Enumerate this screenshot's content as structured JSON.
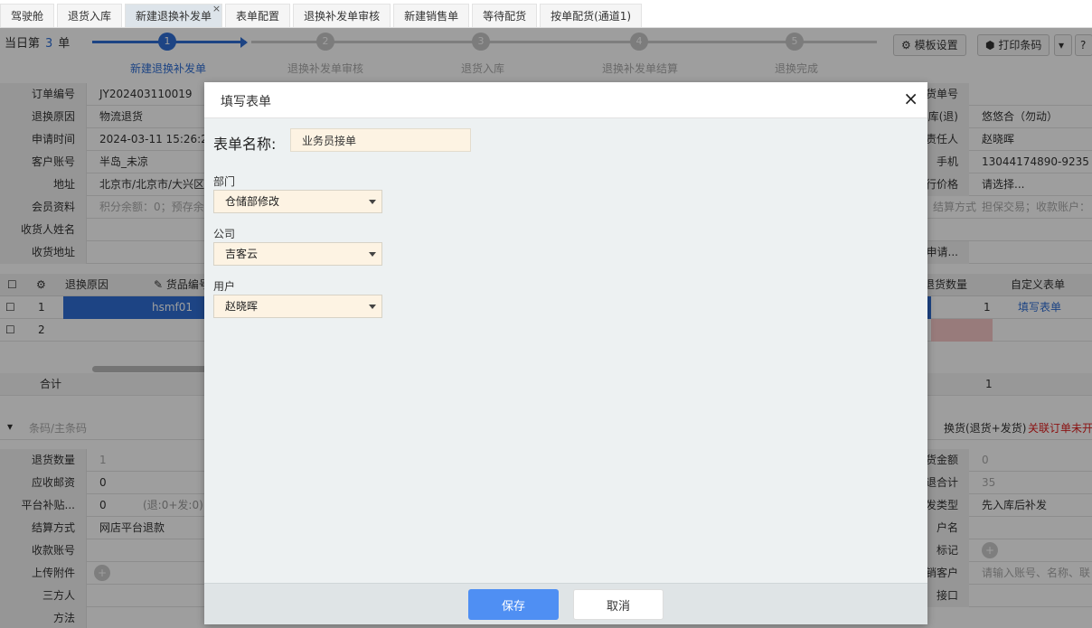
{
  "tabs": [
    {
      "label": "驾驶舱"
    },
    {
      "label": "退货入库"
    },
    {
      "label": "新建退换补发单",
      "active": true,
      "close": "×"
    },
    {
      "label": "表单配置"
    },
    {
      "label": "退换补发单审核"
    },
    {
      "label": "新建销售单"
    },
    {
      "label": "等待配货"
    },
    {
      "label": "按单配货(通道1)"
    }
  ],
  "header": {
    "count_prefix": "当日第",
    "count_value": "3",
    "count_suffix": "单",
    "template_btn": "模板设置",
    "print_btn": "打印条码",
    "help_btn": "?"
  },
  "steps": [
    {
      "num": "1",
      "label": "新建退换补发单"
    },
    {
      "num": "2",
      "label": "退换补发单审核"
    },
    {
      "num": "3",
      "label": "退货入库"
    },
    {
      "num": "4",
      "label": "退换补发单结算"
    },
    {
      "num": "5",
      "label": "退换完成"
    }
  ],
  "form_rows": [
    {
      "label": "订单编号",
      "value": "JY202403110019",
      "right_label": "货单号",
      "right_value": ""
    },
    {
      "label": "退换原因",
      "value": "物流退货",
      "right_label": "库(退)",
      "right_value": "悠悠合（勿动）"
    },
    {
      "label": "申请时间",
      "value": "2024-03-11 15:26:28",
      "right_label": "责任人",
      "right_value": "赵晓晖"
    },
    {
      "label": "客户账号",
      "value": "半岛_未凉",
      "right_label": "手机",
      "right_value": "13044174890-9235"
    },
    {
      "label": "地址",
      "value": "北京市/北京市/大兴区",
      "right_label": "行价格",
      "right_value": "请选择..."
    },
    {
      "label": "会员资料",
      "value": "积分余额：0；预存余",
      "right_label": "结算方式",
      "right_value": "担保交易；收款账户："
    },
    {
      "label": "收货人姓名",
      "value": "",
      "right_label": "",
      "right_value": ""
    },
    {
      "label": "收货地址",
      "value": "",
      "right_label": "申请...",
      "right_value": ""
    }
  ],
  "grid": {
    "headers": {
      "reason": "退换原因",
      "code": "货品编号",
      "return_qty": "退货数量",
      "custom_form": "自定义表单"
    },
    "rows": [
      {
        "num": "1",
        "code": "hsmf01",
        "qty": "1",
        "link": "填写表单"
      },
      {
        "num": "2",
        "code": "",
        "qty": "",
        "link": ""
      }
    ],
    "total_label": "合计",
    "total_qty": "1"
  },
  "barcode_placeholder": "条码/主条码",
  "exchange_text": "换货(退货+发货)",
  "exchange_warn": "关联订单未开",
  "bottom_rows": [
    {
      "label": "退货数量",
      "value": "1",
      "right_label": "货金额",
      "right_value": "0"
    },
    {
      "label": "应收邮资",
      "value": "0",
      "right_label": "退合计",
      "right_value": "35"
    },
    {
      "label": "平台补贴...",
      "value": "0",
      "extra": "(退:0+发:0)",
      "right_label": "发类型",
      "right_value": "先入库后补发"
    },
    {
      "label": "结算方式",
      "value": "网店平台退款",
      "right_label": "户名",
      "right_value": ""
    },
    {
      "label": "收款账号",
      "value": "",
      "right_label": "标记",
      "right_value": ""
    },
    {
      "label": "上传附件",
      "value": "",
      "right_label": "销客户",
      "right_value": "请输入账号、名称、联"
    },
    {
      "label": "三方人",
      "value": "",
      "right_label": "接口",
      "right_value": ""
    },
    {
      "label": "方法",
      "value": "",
      "right_label": "",
      "right_value": ""
    }
  ],
  "modal": {
    "title": "填写表单",
    "close": "×",
    "form_name_label": "表单名称:",
    "form_name_value": "业务员接单",
    "fields": [
      {
        "label": "部门",
        "value": "仓储部修改"
      },
      {
        "label": "公司",
        "value": "吉客云"
      },
      {
        "label": "用户",
        "value": "赵晓晖"
      }
    ],
    "save": "保存",
    "cancel": "取消"
  },
  "colors": {
    "accent": "#4f8ff3",
    "input_bg": "#fdf3e3",
    "link": "#2f6fd6"
  }
}
